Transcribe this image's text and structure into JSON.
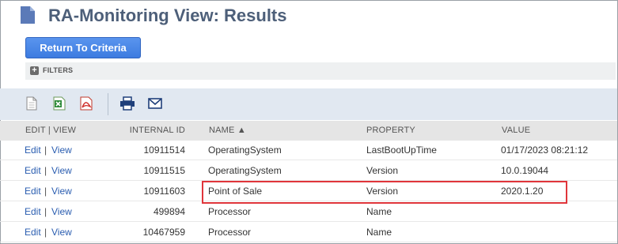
{
  "page": {
    "title": "RA-Monitoring View: Results"
  },
  "buttons": {
    "return_label": "Return To Criteria"
  },
  "filters": {
    "label": "FILTERS",
    "toggle": "+"
  },
  "toolbar": {
    "icons": [
      "document-icon",
      "excel-icon",
      "pdf-icon",
      "print-icon",
      "email-icon"
    ]
  },
  "table": {
    "headers": {
      "edit_view": "EDIT | VIEW",
      "internal_id": "INTERNAL ID",
      "name": "NAME ▲",
      "property": "PROPERTY",
      "value": "VALUE"
    },
    "row_links": {
      "edit": "Edit",
      "separator": "|",
      "view": "View"
    },
    "rows": [
      {
        "internal_id": "10911514",
        "name": "OperatingSystem",
        "property": "LastBootUpTime",
        "value": "01/17/2023 08:21:12"
      },
      {
        "internal_id": "10911515",
        "name": "OperatingSystem",
        "property": "Version",
        "value": "10.0.19044"
      },
      {
        "internal_id": "10911603",
        "name": "Point of Sale",
        "property": "Version",
        "value": "2020.1.20"
      },
      {
        "internal_id": "499894",
        "name": "Processor",
        "property": "Name",
        "value": ""
      },
      {
        "internal_id": "10467959",
        "name": "Processor",
        "property": "Name",
        "value": ""
      }
    ]
  },
  "colors": {
    "highlight_border": "#e0353b",
    "button_blue": "#3d7be0",
    "title": "#4d5f79",
    "link": "#2a5db0"
  }
}
